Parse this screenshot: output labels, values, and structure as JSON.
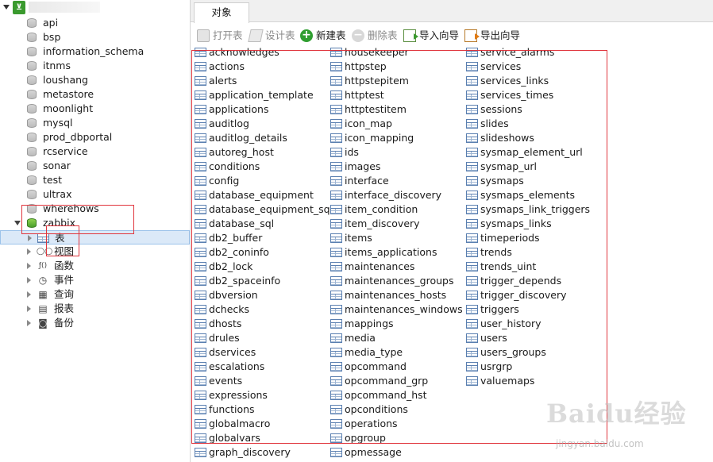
{
  "tree": {
    "databases": [
      {
        "name": "api"
      },
      {
        "name": "bsp"
      },
      {
        "name": "information_schema"
      },
      {
        "name": "itnms"
      },
      {
        "name": "loushang"
      },
      {
        "name": "metastore"
      },
      {
        "name": "moonlight"
      },
      {
        "name": "mysql"
      },
      {
        "name": "prod_dbportal"
      },
      {
        "name": "rcservice"
      },
      {
        "name": "sonar"
      },
      {
        "name": "test"
      },
      {
        "name": "ultrax"
      },
      {
        "name": "wherehows"
      },
      {
        "name": "zabbix"
      }
    ],
    "open_database_children": [
      {
        "label": "表",
        "icon": "table-icon",
        "selected": true
      },
      {
        "label": "视图",
        "icon": "view-icon",
        "selected": false
      },
      {
        "label": "函数",
        "icon": "function-icon",
        "selected": false
      },
      {
        "label": "事件",
        "icon": "event-icon",
        "selected": false
      },
      {
        "label": "查询",
        "icon": "query-icon",
        "selected": false
      },
      {
        "label": "报表",
        "icon": "report-icon",
        "selected": false
      },
      {
        "label": "备份",
        "icon": "backup-icon",
        "selected": false
      }
    ]
  },
  "tabs": {
    "objects": "对象"
  },
  "toolbar": {
    "open_table": "打开表",
    "design_table": "设计表",
    "new_table": "新建表",
    "delete_table": "删除表",
    "import_wizard": "导入向导",
    "export_wizard": "导出向导"
  },
  "objects": {
    "col1": [
      "acknowledges",
      "actions",
      "alerts",
      "application_template",
      "applications",
      "auditlog",
      "auditlog_details",
      "autoreg_host",
      "conditions",
      "config",
      "database_equipment",
      "database_equipment_sql",
      "database_sql",
      "db2_buffer",
      "db2_coninfo",
      "db2_lock",
      "db2_spaceinfo",
      "dbversion",
      "dchecks",
      "dhosts",
      "drules",
      "dservices",
      "escalations",
      "events",
      "expressions",
      "functions",
      "globalmacro",
      "globalvars",
      "graph_discovery"
    ],
    "col2": [
      "housekeeper",
      "httpstep",
      "httpstepitem",
      "httptest",
      "httptestitem",
      "icon_map",
      "icon_mapping",
      "ids",
      "images",
      "interface",
      "interface_discovery",
      "item_condition",
      "item_discovery",
      "items",
      "items_applications",
      "maintenances",
      "maintenances_groups",
      "maintenances_hosts",
      "maintenances_windows",
      "mappings",
      "media",
      "media_type",
      "opcommand",
      "opcommand_grp",
      "opcommand_hst",
      "opconditions",
      "operations",
      "opgroup",
      "opmessage"
    ],
    "col3": [
      "service_alarms",
      "services",
      "services_links",
      "services_times",
      "sessions",
      "slides",
      "slideshows",
      "sysmap_element_url",
      "sysmap_url",
      "sysmaps",
      "sysmaps_elements",
      "sysmaps_link_triggers",
      "sysmaps_links",
      "timeperiods",
      "trends",
      "trends_uint",
      "trigger_depends",
      "trigger_discovery",
      "triggers",
      "user_history",
      "users",
      "users_groups",
      "usrgrp",
      "valuemaps"
    ]
  },
  "watermark": {
    "logo": "Baidu经验",
    "sub": "jingyan.baidu.com"
  },
  "colors": {
    "annotation": "#e0353d",
    "selection": "#dbe9f8",
    "connection": "#3a9a2e"
  }
}
